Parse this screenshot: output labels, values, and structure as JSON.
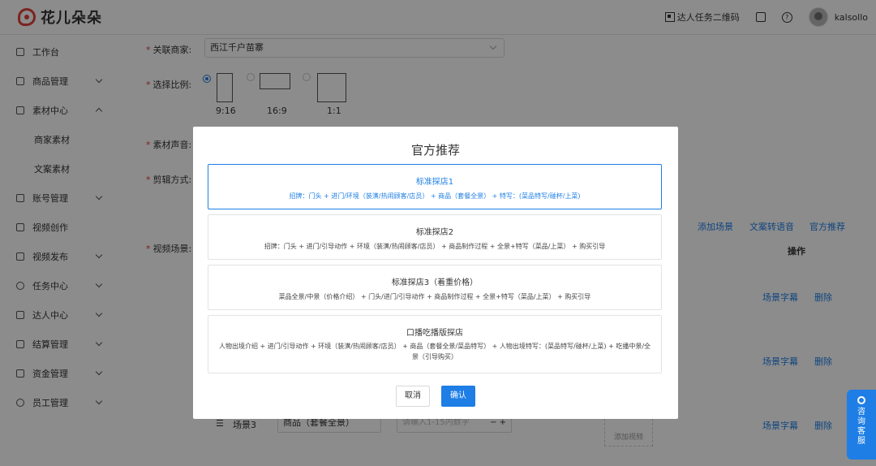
{
  "header": {
    "logo_text": "花儿朵朵",
    "qr_label": "达人任务二维码",
    "username": "kalsollo"
  },
  "sidebar": {
    "items": [
      {
        "label": "工作台"
      },
      {
        "label": "商品管理"
      },
      {
        "label": "素材中心"
      },
      {
        "label": "商家素材"
      },
      {
        "label": "文案素材"
      },
      {
        "label": "账号管理"
      },
      {
        "label": "视频创作"
      },
      {
        "label": "视频发布"
      },
      {
        "label": "任务中心"
      },
      {
        "label": "达人中心"
      },
      {
        "label": "结算管理"
      },
      {
        "label": "资金管理"
      },
      {
        "label": "员工管理"
      }
    ]
  },
  "form": {
    "merchant_label": "关联商家:",
    "merchant_value": "西江千户苗寨",
    "ratio_label": "选择比例:",
    "ratios": [
      "9:16",
      "16:9",
      "1:1"
    ],
    "voice_label": "素材声音:",
    "edit_label": "剪辑方式:",
    "scene_label": "视频场景:",
    "actions": [
      "添加场景",
      "文案转语音",
      "官方推荐"
    ],
    "ops_header": "操作",
    "row_actions": {
      "subtitle": "场景字幕",
      "delete": "删除"
    },
    "scene3_name": "场景3",
    "scene3_type": "商品（套餐全景）",
    "scene3_placeholder": "请输入1-15内数字",
    "stepper": "− +",
    "upload_label": "添加视频"
  },
  "modal": {
    "title": "官方推荐",
    "options": [
      {
        "title": "标准探店1",
        "desc": "招牌：门头 + 进门/环境（装潢/热闹顾客/店员） + 商品（套餐全景） + 特写：(菜品特写/碰杯/上菜)"
      },
      {
        "title": "标准探店2",
        "desc": "招牌：门头 + 进门/引导动作 + 环境（装潢/热闹顾客/店员） + 商品制作过程 + 全景+特写（菜品/上菜） + 购买引导"
      },
      {
        "title": "标准探店3（着重价格）",
        "desc": "菜品全景/中景（价格介绍） + 门头/进门/引导动作 + 商品制作过程 + 全景+特写（菜品/上菜） + 购买引导"
      },
      {
        "title": "口播吃播版探店",
        "desc": "人物出境介绍 + 进门/引导动作 + 环境（装潢/热闹顾客/店员） + 商品（套餐全景/菜品特写） + 人物出境特写：(菜品特写/碰杯/上菜) + 吃播中景/全景（引导购买）"
      }
    ],
    "cancel": "取消",
    "confirm": "确认"
  },
  "service_widget": {
    "text": "咨询客服"
  }
}
